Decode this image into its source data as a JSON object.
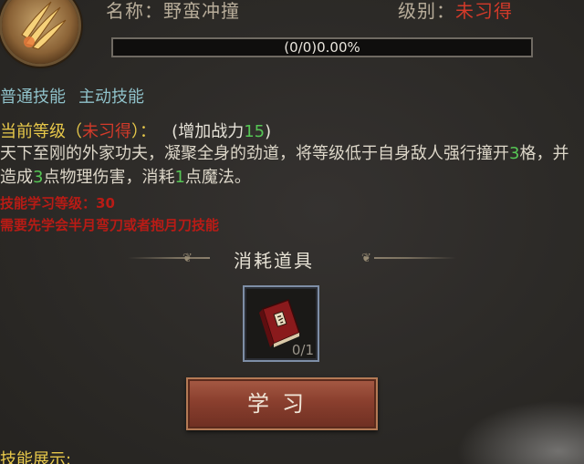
{
  "skill": {
    "icon": "claw-slash-icon",
    "name_label": "名称：",
    "name_value": "野蛮冲撞",
    "level_label": "级别：",
    "level_value": "未习得"
  },
  "progress": {
    "text": "(0/0)0.00%",
    "fraction": 0
  },
  "tags": {
    "type1": "普通技能",
    "type2": "主动技能"
  },
  "current_level": {
    "label_prefix": "当前等级（",
    "status": "未习得",
    "label_suffix": "）：",
    "power_prefix": "(增加战力",
    "power_value": "15",
    "power_suffix": ")"
  },
  "description": {
    "part1": "天下至刚的外家功夫，凝聚全身的劲道，将等级低于自身敌人强行撞开",
    "distance": "3",
    "part2": "格，并造成",
    "damage": "3",
    "part3": "点物理伤害，消耗",
    "mana": "1",
    "part4": "点魔法。"
  },
  "requirements": {
    "line1": "技能学习等级：30",
    "line2": "需要先学会半月弯刀或者抱月刀技能"
  },
  "consumables": {
    "title": "消耗道具",
    "item_icon": "skill-book-icon",
    "item_count": "0/1"
  },
  "learn_button": "学习",
  "showcase_label": "技能展示:",
  "colors": {
    "red": "#d23a2a",
    "gold": "#e7c84a",
    "green": "#56c655",
    "cyan": "#8fc1c9"
  }
}
